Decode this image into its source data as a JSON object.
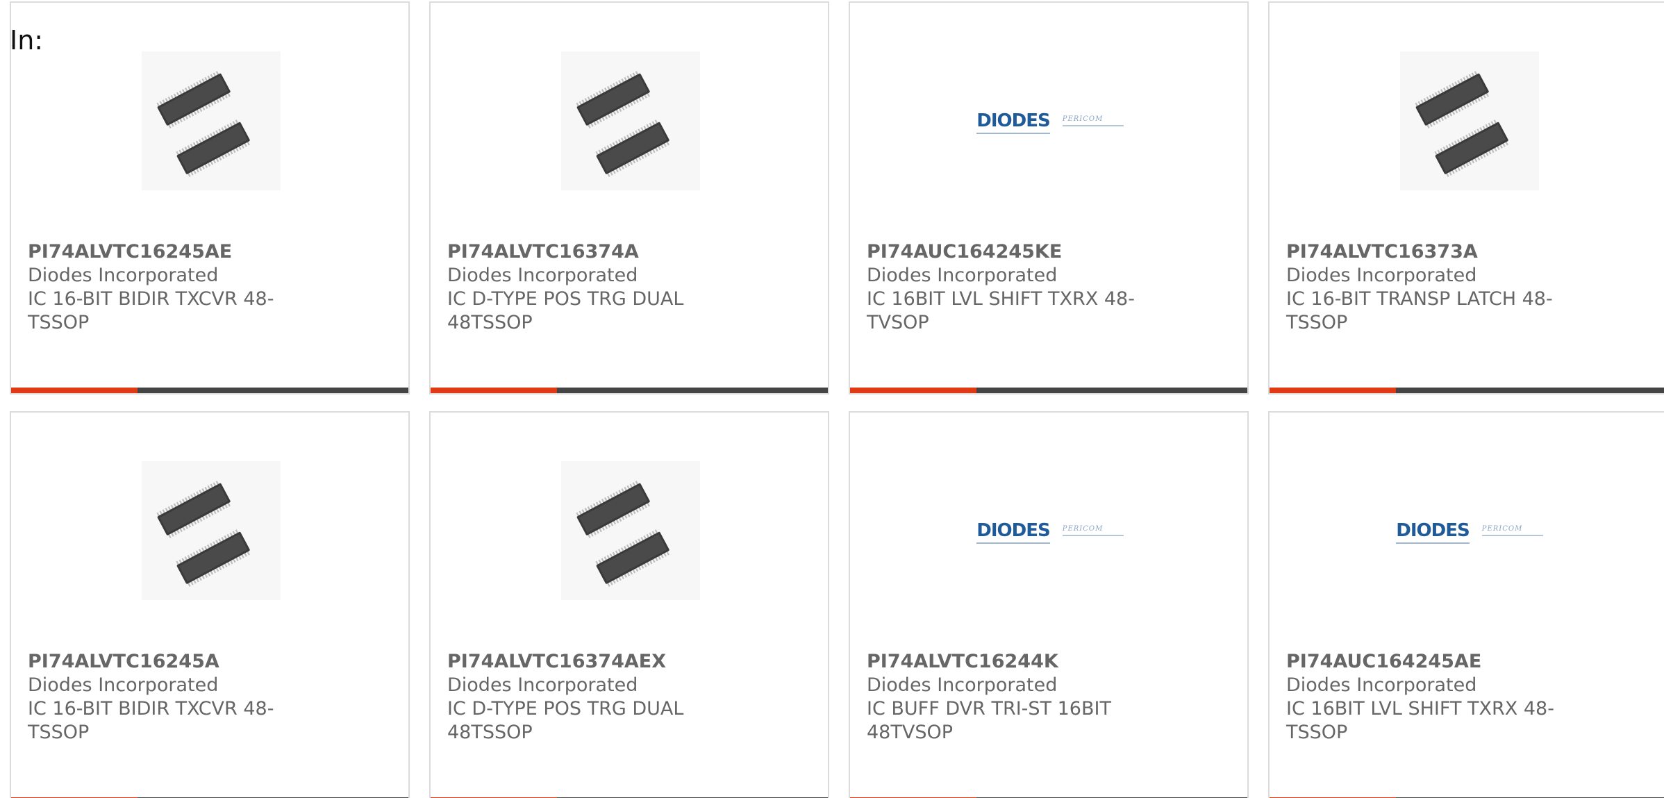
{
  "header": {
    "in_label": "In:"
  },
  "colors": {
    "accent": "#e03a14",
    "bar_dark": "#444444",
    "logo_blue": "#1f5b99",
    "logo_light_blue": "#8aa6c4"
  },
  "products": [
    {
      "part_number": "PI74ALVTC16245AE",
      "manufacturer": "Diodes Incorporated",
      "description": "IC 16-BIT BIDIR TXCVR 48-TSSOP",
      "image": "tssop-chip-image"
    },
    {
      "part_number": "PI74ALVTC16374A",
      "manufacturer": "Diodes Incorporated",
      "description": "IC D-TYPE POS TRG DUAL 48TSSOP",
      "image": "tssop-chip-image"
    },
    {
      "part_number": "PI74AUC164245KE",
      "manufacturer": "Diodes Incorporated",
      "description": "IC 16BIT LVL SHIFT TXRX 48-TVSOP",
      "image": "diodes-pericom-logo",
      "logo_text": "DIODES",
      "logo_subtext": "PERICOM"
    },
    {
      "part_number": "PI74ALVTC16373A",
      "manufacturer": "Diodes Incorporated",
      "description": "IC 16-BIT TRANSP LATCH 48-TSSOP",
      "image": "tssop-chip-image"
    },
    {
      "part_number": "PI74ALVTC16245A",
      "manufacturer": "Diodes Incorporated",
      "description": "IC 16-BIT BIDIR TXCVR 48-TSSOP",
      "image": "tssop-chip-image"
    },
    {
      "part_number": "PI74ALVTC16374AEX",
      "manufacturer": "Diodes Incorporated",
      "description": "IC D-TYPE POS TRG DUAL 48TSSOP",
      "image": "tssop-chip-image"
    },
    {
      "part_number": "PI74ALVTC16244K",
      "manufacturer": "Diodes Incorporated",
      "description": "IC BUFF DVR TRI-ST 16BIT 48TVSOP",
      "image": "diodes-pericom-logo",
      "logo_text": "DIODES",
      "logo_subtext": "PERICOM"
    },
    {
      "part_number": "PI74AUC164245AE",
      "manufacturer": "Diodes Incorporated",
      "description": "IC 16BIT LVL SHIFT TXRX 48-TSSOP",
      "image": "diodes-pericom-logo",
      "logo_text": "DIODES",
      "logo_subtext": "PERICOM"
    }
  ]
}
